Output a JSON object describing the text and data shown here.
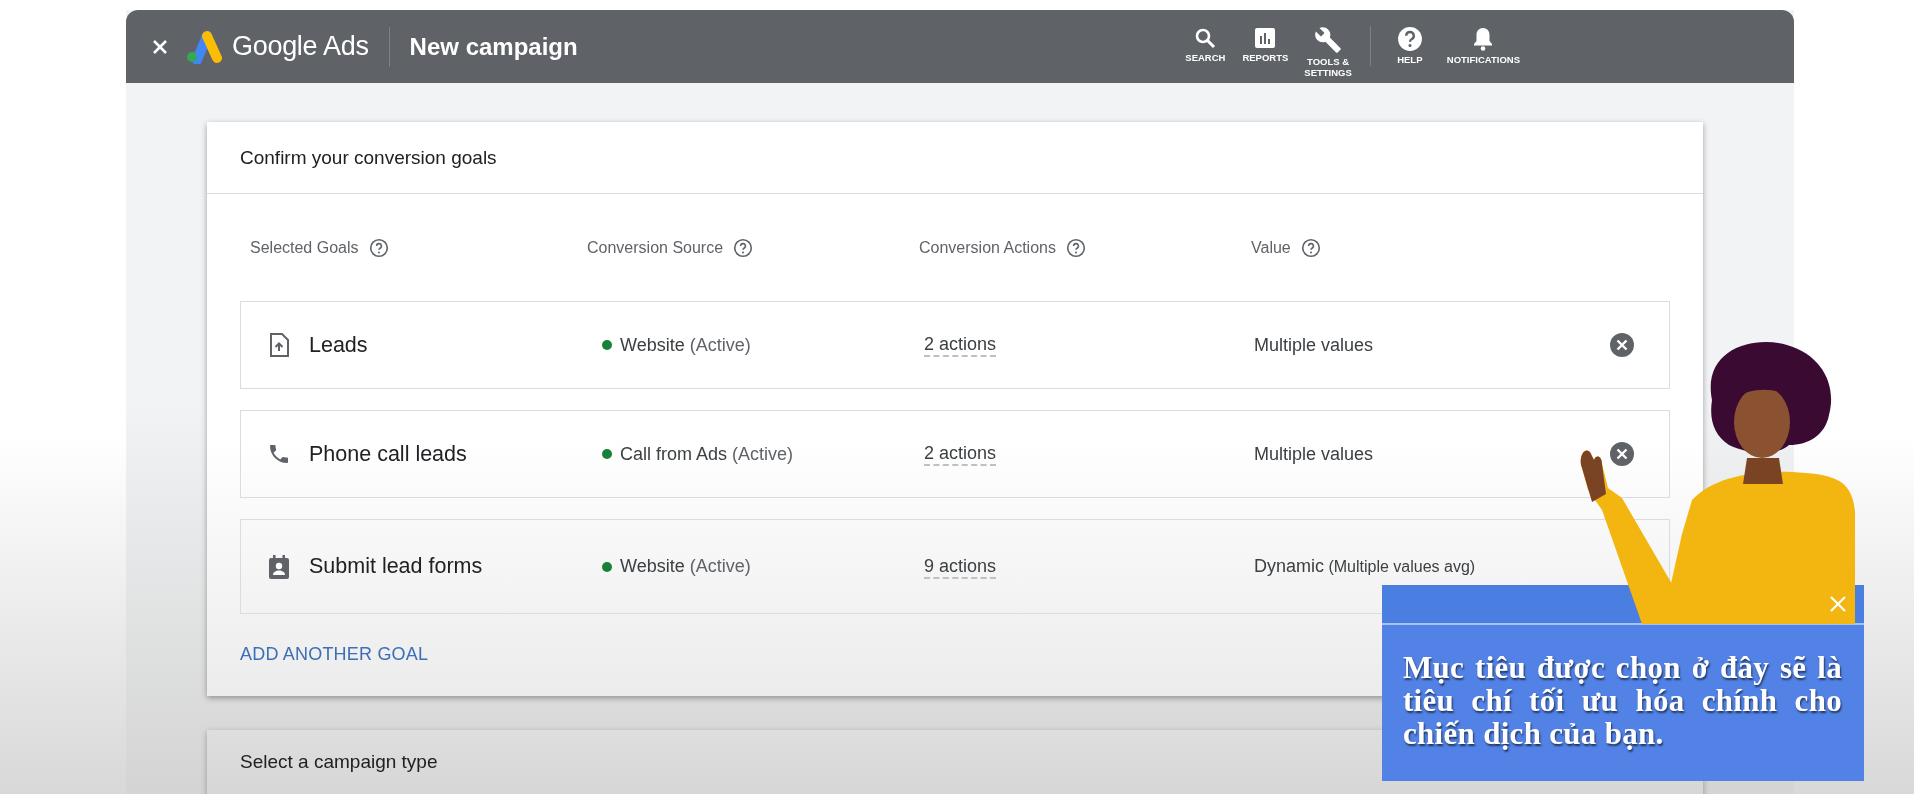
{
  "app": {
    "title": "Google Ads",
    "page": "New campaign"
  },
  "toolbar": [
    {
      "label": "SEARCH",
      "kind": "search",
      "divider_before": false
    },
    {
      "label": "REPORTS",
      "kind": "reports",
      "divider_before": false
    },
    {
      "label": "TOOLS & SETTINGS",
      "kind": "tools",
      "divider_before": false
    },
    {
      "label": "HELP",
      "kind": "help",
      "divider_before": true
    },
    {
      "label": "NOTIFICATIONS",
      "kind": "notifications",
      "divider_before": false
    }
  ],
  "goals_card": {
    "title": "Confirm your conversion goals",
    "columns": [
      "Selected Goals",
      "Conversion Source",
      "Conversion Actions",
      "Value"
    ],
    "rows": [
      {
        "kind": "upload",
        "name": "Leads",
        "source": "Website",
        "status": "(Active)",
        "actions": "2 actions",
        "value": "Multiple values",
        "removable": true
      },
      {
        "kind": "phone",
        "name": "Phone call leads",
        "source": "Call from Ads",
        "status": "(Active)",
        "actions": "2 actions",
        "value": "Multiple values",
        "removable": true
      },
      {
        "kind": "form",
        "name": "Submit lead forms",
        "source": "Website",
        "status": "(Active)",
        "actions": "9 actions",
        "value": "Dynamic",
        "value_note": "(Multiple values avg)",
        "removable": false
      }
    ],
    "add_link": "ADD ANOTHER GOAL"
  },
  "campaign_type_card": {
    "title": "Select a campaign type"
  },
  "tip": {
    "text": "Mục tiêu được chọn ở đây sẽ là tiêu chí tối ưu hóa chính cho chiến dịch của bạn."
  }
}
